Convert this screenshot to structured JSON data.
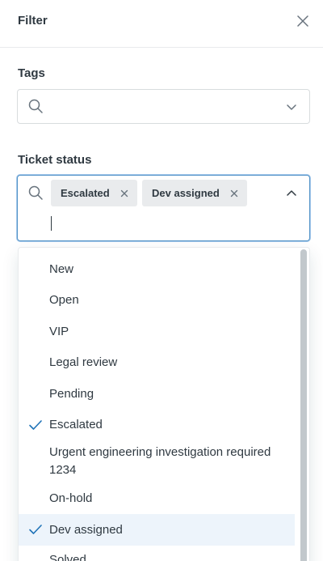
{
  "header": {
    "title": "Filter",
    "close_icon": "close-icon"
  },
  "tags": {
    "label": "Tags",
    "search_value": "",
    "icons": {
      "search": "search-icon",
      "expand": "chevron-down-icon"
    }
  },
  "ticket_status": {
    "label": "Ticket status",
    "search_value": "",
    "selected_tags": [
      {
        "label": "Escalated",
        "remove_icon": "close-icon"
      },
      {
        "label": "Dev assigned",
        "remove_icon": "close-icon"
      }
    ],
    "icons": {
      "search": "search-icon",
      "collapse": "chevron-up-icon"
    },
    "options": [
      {
        "label": "New",
        "selected": false
      },
      {
        "label": "Open",
        "selected": false
      },
      {
        "label": "VIP",
        "selected": false
      },
      {
        "label": "Legal review",
        "selected": false
      },
      {
        "label": "Pending",
        "selected": false
      },
      {
        "label": "Escalated",
        "selected": true
      },
      {
        "label": "Urgent engineering investigation required 1234",
        "selected": false
      },
      {
        "label": "On-hold",
        "selected": false
      },
      {
        "label": "Dev assigned",
        "selected": true,
        "highlighted": true
      },
      {
        "label": "Solved",
        "selected": false
      }
    ]
  },
  "colors": {
    "text": "#2f3941",
    "focus_border": "#5293c7",
    "check": "#1f73b7",
    "highlight_bg": "#edf4fb",
    "tag_bg": "#e9ebed"
  }
}
